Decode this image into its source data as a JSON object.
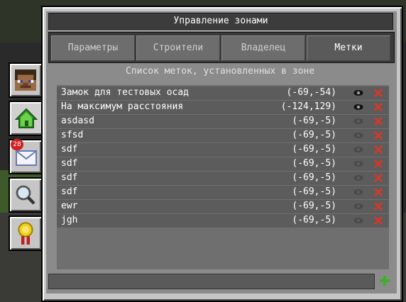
{
  "window": {
    "title": "Управление зонами"
  },
  "tabs": [
    {
      "label": "Параметры"
    },
    {
      "label": "Строители"
    },
    {
      "label": "Владелец"
    },
    {
      "label": "Метки"
    }
  ],
  "side_tabs": {
    "messages_badge": "28",
    "icons": [
      "player-head-icon",
      "home-icon",
      "mail-icon",
      "magnifier-icon",
      "medal-icon"
    ]
  },
  "marks": {
    "heading": "Список меток, установленных в зоне",
    "rows": [
      {
        "name": "Замок для тестовых осад",
        "coords": "(-69,-54)",
        "visible": true
      },
      {
        "name": "На максимум расстояния",
        "coords": "(-124,129)",
        "visible": true
      },
      {
        "name": "asdasd",
        "coords": "(-69,-5)",
        "visible": false
      },
      {
        "name": "sfsd",
        "coords": "(-69,-5)",
        "visible": false
      },
      {
        "name": "sdf",
        "coords": "(-69,-5)",
        "visible": false
      },
      {
        "name": "sdf",
        "coords": "(-69,-5)",
        "visible": false
      },
      {
        "name": "sdf",
        "coords": "(-69,-5)",
        "visible": false
      },
      {
        "name": "sdf",
        "coords": "(-69,-5)",
        "visible": false
      },
      {
        "name": "ewr",
        "coords": "(-69,-5)",
        "visible": false
      },
      {
        "name": "jgh",
        "coords": "(-69,-5)",
        "visible": false
      }
    ]
  },
  "new_mark": {
    "value": ""
  },
  "colors": {
    "delete": "#d03a2a",
    "add": "#3fae2a",
    "eye_on": "#111111",
    "eye_off": "#4a4a4a"
  }
}
